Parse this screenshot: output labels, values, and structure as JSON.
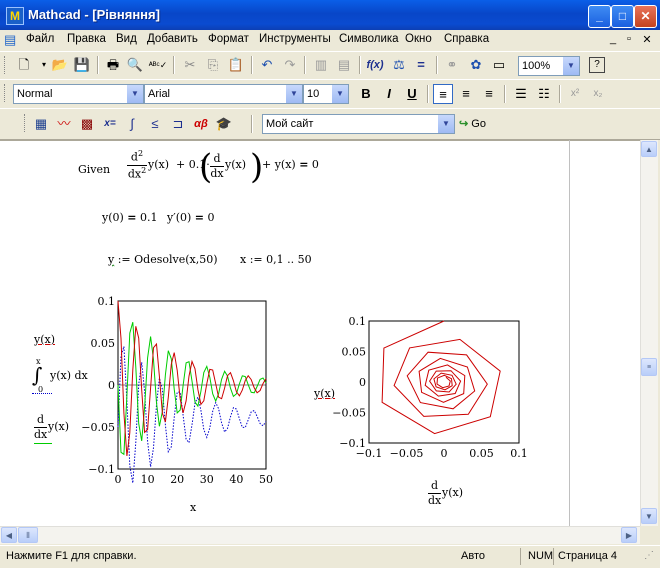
{
  "window": {
    "title": "Mathcad - [Рівняння]",
    "app_icon": "mathcad-icon"
  },
  "menu": [
    "Файл",
    "Правка",
    "Вид",
    "Добавить",
    "Формат",
    "Инструменты",
    "Символика",
    "Окно",
    "Справка"
  ],
  "format_bar": {
    "style": "Normal",
    "font": "Arial",
    "size": "10"
  },
  "standard_bar": {
    "zoom": "100%"
  },
  "resource_bar": {
    "site": "Мой сайт",
    "go": "Go"
  },
  "worksheet": {
    "given": "Given",
    "ode": "d²/dx² y(x) + 0.1·(d/dx y(x)) + y(x) = 0",
    "init1": "y(0) = 0.1",
    "init2": "y′(0) = 0",
    "solve": "y := Odesolve(x,50)",
    "range": "x := 0,1 .. 50"
  },
  "plot1": {
    "ylabels": [
      "y(x)",
      "∫₀ˣ y(x) dx",
      "d/dx y(x)"
    ],
    "xlabel": "x",
    "yticks": [
      "0.1",
      "0.05",
      "0",
      "−0.05",
      "−0.1"
    ],
    "xticks": [
      "0",
      "10",
      "20",
      "30",
      "40",
      "50"
    ]
  },
  "plot2": {
    "ylabel": "y(x)",
    "xlabel": "d/dx y(x)",
    "yticks": [
      "0.1",
      "0.05",
      "0",
      "−0.05",
      "−0.1"
    ],
    "xticks": [
      "−0.1",
      "−0.05",
      "0",
      "0.05",
      "0.1"
    ]
  },
  "status": {
    "help": "Нажмите F1 для справки.",
    "mode": "Авто",
    "num": "NUM",
    "page": "Страница 4"
  },
  "colors": {
    "title_bar": "#0A4BD0",
    "series_y": "#CC0000",
    "series_int": "#0000CC",
    "series_dy": "#00CC00"
  }
}
